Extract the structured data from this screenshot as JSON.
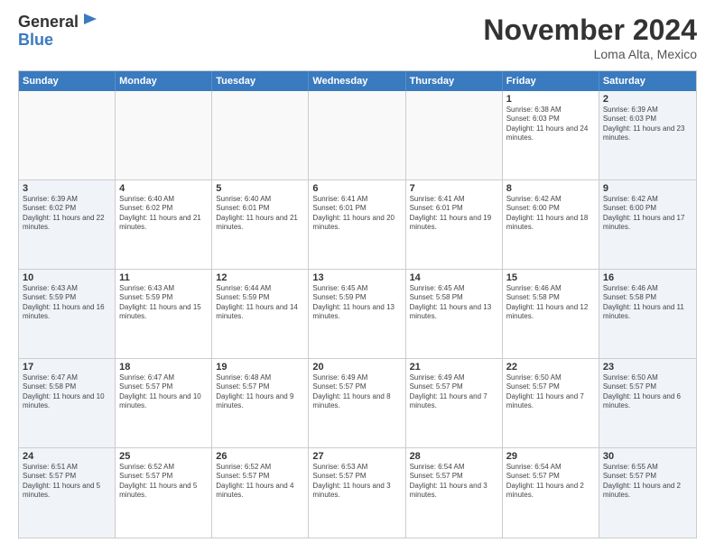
{
  "header": {
    "logo_line1": "General",
    "logo_line2": "Blue",
    "month_title": "November 2024",
    "location": "Loma Alta, Mexico"
  },
  "days_of_week": [
    "Sunday",
    "Monday",
    "Tuesday",
    "Wednesday",
    "Thursday",
    "Friday",
    "Saturday"
  ],
  "weeks": [
    [
      {
        "day": "",
        "empty": true
      },
      {
        "day": "",
        "empty": true
      },
      {
        "day": "",
        "empty": true
      },
      {
        "day": "",
        "empty": true
      },
      {
        "day": "",
        "empty": true
      },
      {
        "day": "1",
        "sunrise": "6:38 AM",
        "sunset": "6:03 PM",
        "daylight": "11 hours and 24 minutes."
      },
      {
        "day": "2",
        "sunrise": "6:39 AM",
        "sunset": "6:03 PM",
        "daylight": "11 hours and 23 minutes.",
        "weekend": true
      }
    ],
    [
      {
        "day": "3",
        "sunrise": "6:39 AM",
        "sunset": "6:02 PM",
        "daylight": "11 hours and 22 minutes.",
        "weekend": true
      },
      {
        "day": "4",
        "sunrise": "6:40 AM",
        "sunset": "6:02 PM",
        "daylight": "11 hours and 21 minutes."
      },
      {
        "day": "5",
        "sunrise": "6:40 AM",
        "sunset": "6:01 PM",
        "daylight": "11 hours and 21 minutes."
      },
      {
        "day": "6",
        "sunrise": "6:41 AM",
        "sunset": "6:01 PM",
        "daylight": "11 hours and 20 minutes."
      },
      {
        "day": "7",
        "sunrise": "6:41 AM",
        "sunset": "6:01 PM",
        "daylight": "11 hours and 19 minutes."
      },
      {
        "day": "8",
        "sunrise": "6:42 AM",
        "sunset": "6:00 PM",
        "daylight": "11 hours and 18 minutes."
      },
      {
        "day": "9",
        "sunrise": "6:42 AM",
        "sunset": "6:00 PM",
        "daylight": "11 hours and 17 minutes.",
        "weekend": true
      }
    ],
    [
      {
        "day": "10",
        "sunrise": "6:43 AM",
        "sunset": "5:59 PM",
        "daylight": "11 hours and 16 minutes.",
        "weekend": true
      },
      {
        "day": "11",
        "sunrise": "6:43 AM",
        "sunset": "5:59 PM",
        "daylight": "11 hours and 15 minutes."
      },
      {
        "day": "12",
        "sunrise": "6:44 AM",
        "sunset": "5:59 PM",
        "daylight": "11 hours and 14 minutes."
      },
      {
        "day": "13",
        "sunrise": "6:45 AM",
        "sunset": "5:59 PM",
        "daylight": "11 hours and 13 minutes."
      },
      {
        "day": "14",
        "sunrise": "6:45 AM",
        "sunset": "5:58 PM",
        "daylight": "11 hours and 13 minutes."
      },
      {
        "day": "15",
        "sunrise": "6:46 AM",
        "sunset": "5:58 PM",
        "daylight": "11 hours and 12 minutes."
      },
      {
        "day": "16",
        "sunrise": "6:46 AM",
        "sunset": "5:58 PM",
        "daylight": "11 hours and 11 minutes.",
        "weekend": true
      }
    ],
    [
      {
        "day": "17",
        "sunrise": "6:47 AM",
        "sunset": "5:58 PM",
        "daylight": "11 hours and 10 minutes.",
        "weekend": true
      },
      {
        "day": "18",
        "sunrise": "6:47 AM",
        "sunset": "5:57 PM",
        "daylight": "11 hours and 10 minutes."
      },
      {
        "day": "19",
        "sunrise": "6:48 AM",
        "sunset": "5:57 PM",
        "daylight": "11 hours and 9 minutes."
      },
      {
        "day": "20",
        "sunrise": "6:49 AM",
        "sunset": "5:57 PM",
        "daylight": "11 hours and 8 minutes."
      },
      {
        "day": "21",
        "sunrise": "6:49 AM",
        "sunset": "5:57 PM",
        "daylight": "11 hours and 7 minutes."
      },
      {
        "day": "22",
        "sunrise": "6:50 AM",
        "sunset": "5:57 PM",
        "daylight": "11 hours and 7 minutes."
      },
      {
        "day": "23",
        "sunrise": "6:50 AM",
        "sunset": "5:57 PM",
        "daylight": "11 hours and 6 minutes.",
        "weekend": true
      }
    ],
    [
      {
        "day": "24",
        "sunrise": "6:51 AM",
        "sunset": "5:57 PM",
        "daylight": "11 hours and 5 minutes.",
        "weekend": true
      },
      {
        "day": "25",
        "sunrise": "6:52 AM",
        "sunset": "5:57 PM",
        "daylight": "11 hours and 5 minutes."
      },
      {
        "day": "26",
        "sunrise": "6:52 AM",
        "sunset": "5:57 PM",
        "daylight": "11 hours and 4 minutes."
      },
      {
        "day": "27",
        "sunrise": "6:53 AM",
        "sunset": "5:57 PM",
        "daylight": "11 hours and 3 minutes."
      },
      {
        "day": "28",
        "sunrise": "6:54 AM",
        "sunset": "5:57 PM",
        "daylight": "11 hours and 3 minutes."
      },
      {
        "day": "29",
        "sunrise": "6:54 AM",
        "sunset": "5:57 PM",
        "daylight": "11 hours and 2 minutes."
      },
      {
        "day": "30",
        "sunrise": "6:55 AM",
        "sunset": "5:57 PM",
        "daylight": "11 hours and 2 minutes.",
        "weekend": true
      }
    ]
  ]
}
